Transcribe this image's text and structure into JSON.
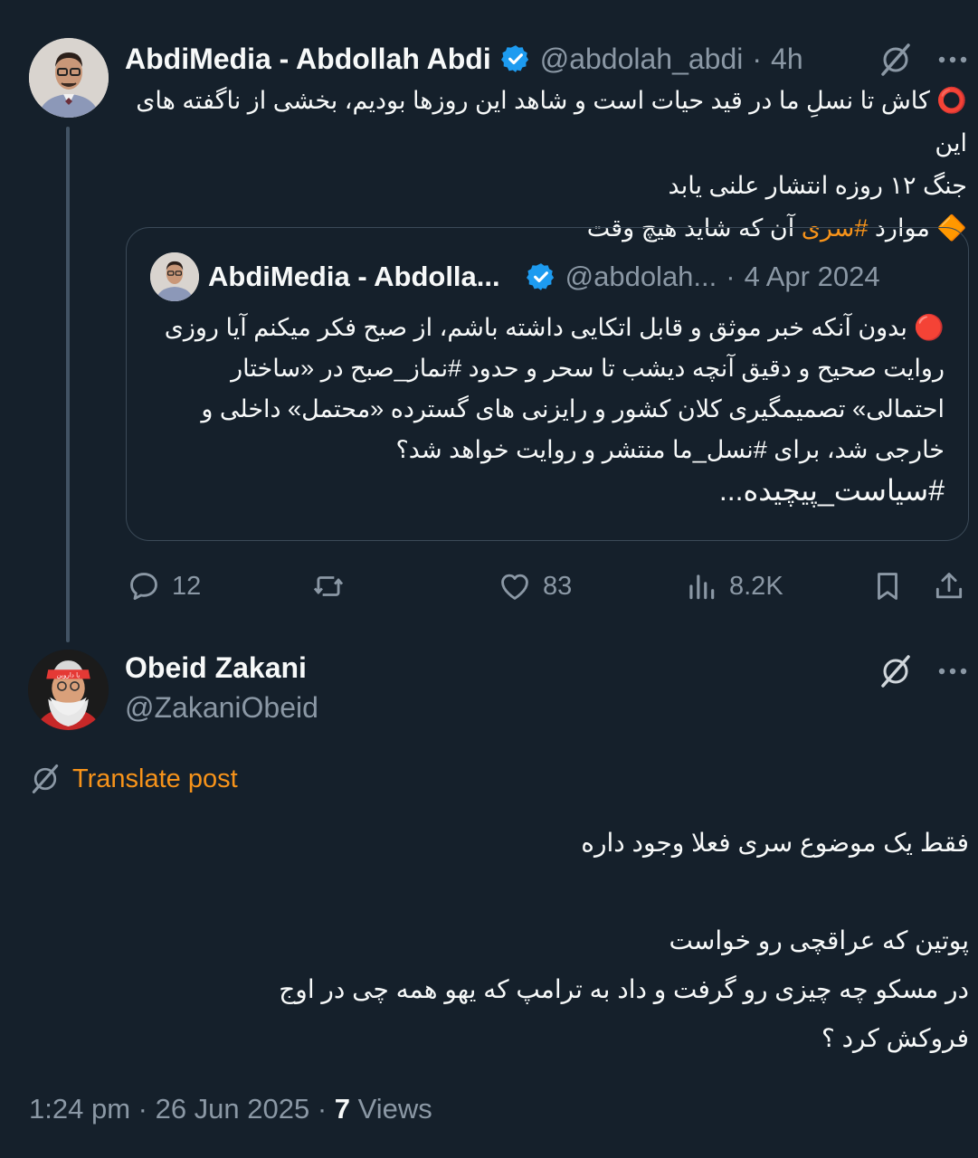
{
  "parent": {
    "name": "AbdiMedia - Abdollah Abdi",
    "handle": "@abdolah_abdi",
    "time": "4h",
    "text_line1": "⭕ کاش تا نسلِ ما در قید حیات است و شاهد این روزها بودیم، بخشی از ناگفته های این",
    "text_line2": "جنگ ۱۲ روزه انتشار علنی یابد",
    "text_line3_before": "🔶 موارد ",
    "text_line3_hashtag": "#سری",
    "text_line3_after": " آن که شاید هیچ وقت"
  },
  "quote": {
    "name": "AbdiMedia - Abdolla...",
    "handle": "@abdolah...",
    "date": "4 Apr 2024",
    "line1": "🔴 بدون آنکه خبر موثق و قابل اتکایی داشته باشم، از صبح فکر میکنم آیا روزی",
    "line2": "روایت صحیح و دقیق آنچه دیشب تا سحر و حدود #نماز_صبح  در «ساختار",
    "line3": "احتمالی» تصمیمگیری کلان کشور و رایزنی های گسترده «محتمل» داخلی و",
    "line4": "خارجی شد، برای #نسل_ما منتشر و روایت خواهد شد؟",
    "line5": "#سیاست_پیچیده..."
  },
  "actions": {
    "replies": "12",
    "likes": "83",
    "views": "8.2K"
  },
  "reply": {
    "name": "Obeid Zakani",
    "handle": "@ZakaniObeid",
    "avatar_band_text": "یا داروین",
    "translate_label": "Translate post",
    "line1": "فقط یک موضوع سری فعلا وجود داره",
    "line2": "",
    "line3": "پوتین که عراقچی رو خواست",
    "line4": "در مسکو چه چیزی رو گرفت و داد به ترامپ که یهو همه چی در اوج",
    "line5": "فروکش کرد ؟",
    "time": "1:24 pm",
    "date": "26 Jun 2025",
    "views_count": "7",
    "views_label": "Views"
  },
  "colors": {
    "background": "#15202b",
    "muted": "#8b98a5",
    "accent_orange": "#f7931a",
    "verified_blue": "#1d9bf0"
  }
}
